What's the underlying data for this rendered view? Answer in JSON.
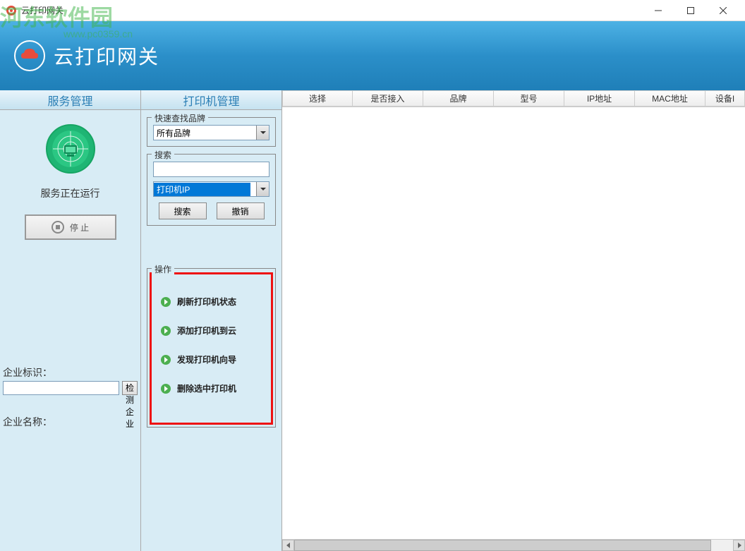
{
  "titlebar": {
    "title": "云打印网关"
  },
  "header": {
    "title": "云打印网关"
  },
  "watermark": {
    "text": "河东软件园",
    "url": "www.pc0359.cn"
  },
  "tabs": {
    "service": "服务管理",
    "printer": "打印机管理"
  },
  "service": {
    "status": "服务正在运行",
    "stop_label": "停 止"
  },
  "company": {
    "id_label": "企业标识：",
    "detect_label": "检测企业",
    "name_label": "企业名称：",
    "id_value": "",
    "name_value": ""
  },
  "quickfind": {
    "legend": "快速查找品牌",
    "selected": "所有品牌"
  },
  "search": {
    "legend": "搜索",
    "input_value": "",
    "type_selected": "打印机IP",
    "search_btn": "搜索",
    "undo_btn": "撤销"
  },
  "ops": {
    "legend": "操作",
    "items": [
      "刷新打印机状态",
      "添加打印机到云",
      "发现打印机向导",
      "删除选中打印机"
    ]
  },
  "table": {
    "headers": [
      "选择",
      "是否接入",
      "品牌",
      "型号",
      "IP地址",
      "MAC地址",
      "设备I"
    ]
  }
}
